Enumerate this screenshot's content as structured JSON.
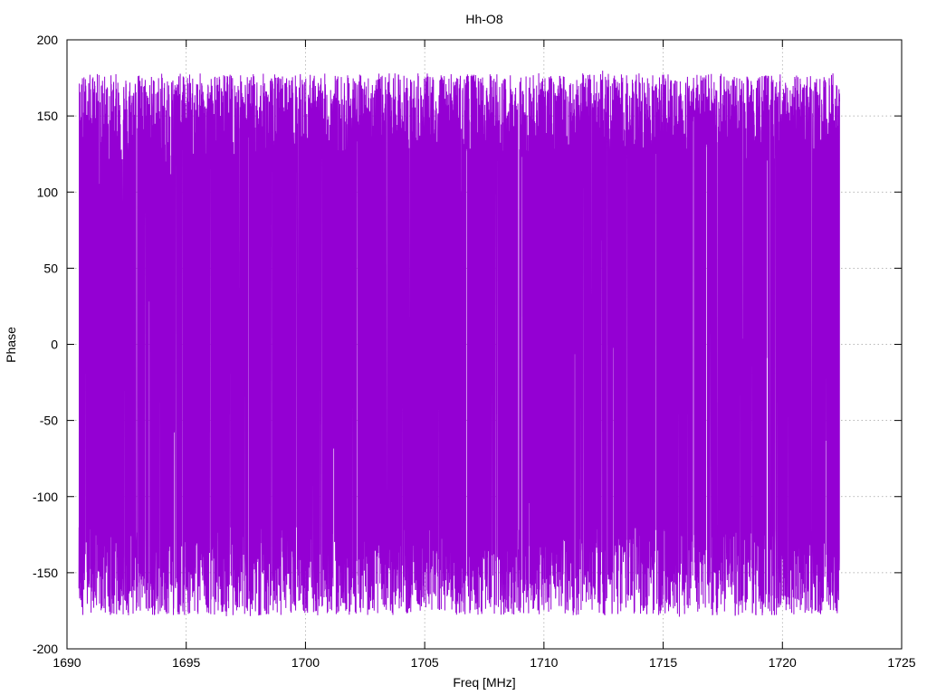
{
  "chart_data": {
    "type": "line",
    "title": "Hh-O8",
    "xlabel": "Freq [MHz]",
    "ylabel": "Phase",
    "xlim": [
      1690,
      1725
    ],
    "ylim": [
      -200,
      200
    ],
    "grid": true,
    "x_ticks": [
      1690,
      1695,
      1700,
      1705,
      1710,
      1715,
      1720,
      1725
    ],
    "y_ticks": [
      200,
      150,
      100,
      50,
      0,
      -50,
      -100,
      -150,
      -200
    ],
    "x_tick_labels": [
      "1690",
      "1695",
      "1700",
      "1705",
      "1710",
      "1715",
      "1720",
      "1725"
    ],
    "y_tick_labels": [
      "200",
      "150",
      "100",
      "50",
      "0",
      "-50",
      "-100",
      "-150",
      "-200"
    ],
    "series": [
      {
        "color": "#9400d3",
        "x_range": [
          1690.5,
          1722.4
        ],
        "y_range": [
          -180,
          180
        ],
        "description_values": "dense phase wrap between -180 and 180 across the band"
      }
    ]
  }
}
